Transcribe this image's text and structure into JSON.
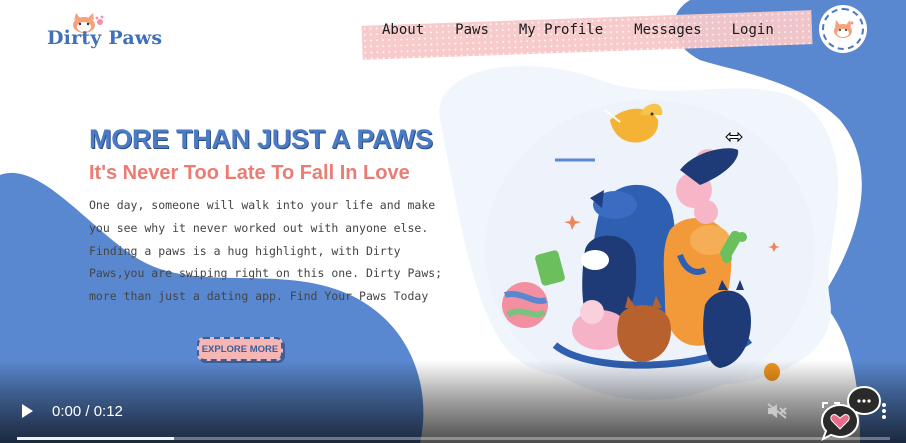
{
  "brand": {
    "name": "Dirty Paws",
    "color": "#4070b8"
  },
  "nav": {
    "items": [
      "About",
      "Paws",
      "My Profile",
      "Messages",
      "Login"
    ]
  },
  "hero": {
    "title": "MORE THAN JUST A PAWS",
    "subtitle": "It's Never Too Late To Fall In Love",
    "body_lines": [
      "One day, someone will walk into your life and make",
      "you see why it never worked out with anyone else.",
      "Finding a paws is a hug highlight, with Dirty",
      "Paws,you are swiping right on this one. Dirty Paws;",
      "more than just a dating app. Find Your Paws Today"
    ],
    "cta_label": "EXPLORE MORE"
  },
  "video": {
    "time": "0:00 / 0:12",
    "progress": 0.18
  },
  "icons": {
    "avatar": "cat-avatar-icon",
    "play": "play-icon",
    "mute": "muted-speaker-icon",
    "fullscreen": "fullscreen-icon",
    "more": "more-vertical-icon",
    "chat": "chat-bubble-icon",
    "heart": "heart-icon"
  },
  "colors": {
    "blue": "#4a7bc4",
    "light_blue": "#7ea6e0",
    "pink": "#f7b6b6",
    "coral": "#ec7c73"
  }
}
